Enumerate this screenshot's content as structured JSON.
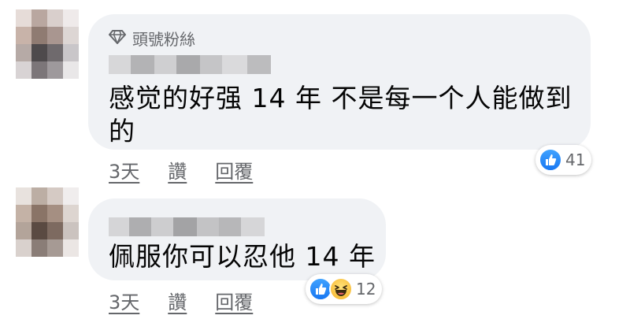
{
  "comments": [
    {
      "badge": "頭號粉絲",
      "text_line1": "感觉的好强 14 年 不是每一个人能做到",
      "text_line2": "的",
      "time": "3天",
      "like_label": "讚",
      "reply_label": "回覆",
      "reaction_count": "41",
      "reactions": [
        "like-icon"
      ]
    },
    {
      "text_line1": "佩服你可以忍他 14 年",
      "time": "3天",
      "like_label": "讚",
      "reply_label": "回覆",
      "reaction_count": "12",
      "reactions": [
        "like-icon",
        "haha-icon"
      ]
    }
  ],
  "colors": {
    "bubble": "#f0f2f5",
    "like_blue": "#1877f2",
    "meta_text": "#65676b"
  }
}
